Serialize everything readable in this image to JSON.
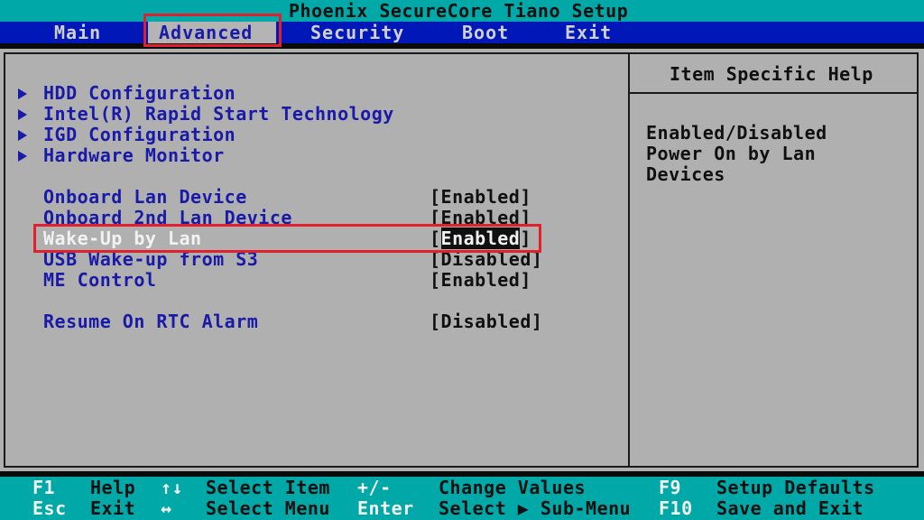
{
  "title": "Phoenix SecureCore Tiano Setup",
  "menu": {
    "main": "Main",
    "advanced": "Advanced",
    "security": "Security",
    "boot": "Boot",
    "exit": "Exit",
    "active": "Advanced"
  },
  "submenus": [
    {
      "label": "HDD Configuration"
    },
    {
      "label": "Intel(R) Rapid Start Technology"
    },
    {
      "label": "IGD Configuration"
    },
    {
      "label": "Hardware Monitor"
    }
  ],
  "settings": [
    {
      "label": "Onboard Lan Device",
      "value": "Enabled"
    },
    {
      "label": "Onboard 2nd Lan Device",
      "value": "Enabled"
    },
    {
      "label": "Wake-Up by Lan",
      "value": "Enabled",
      "selected": true
    },
    {
      "label": "USB Wake-up from S3",
      "value": "Disabled"
    },
    {
      "label": "ME Control",
      "value": "Enabled"
    },
    {
      "label": "Resume On RTC Alarm",
      "value": "Disabled"
    }
  ],
  "help": {
    "title": "Item Specific Help",
    "lines": [
      "Enabled/Disabled",
      "Power On by Lan",
      "Devices"
    ]
  },
  "footer": {
    "f1_key": "F1",
    "f1_desc": "Help",
    "esc_key": "Esc",
    "esc_desc": "Exit",
    "updown_key": "↑↓",
    "updown_desc": "Select Item",
    "leftright_key": "↔",
    "leftright_desc": "Select Menu",
    "plusminus_key": "+/-",
    "plusminus_desc": "Change Values",
    "enter_key": "Enter",
    "enter_desc": "Select ▶ Sub-Menu",
    "f9_key": "F9",
    "f9_desc": "Setup Defaults",
    "f10_key": "F10",
    "f10_desc": "Save and Exit"
  },
  "colors": {
    "menubar": "#0018b8",
    "titlebar": "#00a8a8",
    "panel": "#b0b0b0",
    "item_text": "#1a1aa8",
    "highlight_box": "#e0202c"
  }
}
